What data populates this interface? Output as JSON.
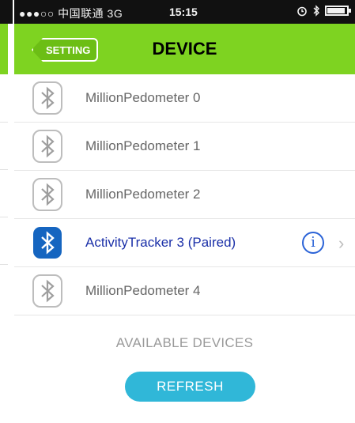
{
  "status_bar": {
    "left": "●●●○○ 中国联通  3G",
    "time": "15:15",
    "alarm_icon": "alarm-icon",
    "bluetooth_icon": "bluetooth-icon",
    "battery_icon": "battery-icon"
  },
  "navbar": {
    "back_label": "SETTING",
    "title": "DEVICE",
    "color": "#7ed321"
  },
  "devices": [
    {
      "name": "MillionPedometer 0",
      "paired": false,
      "icon": "bluetooth-gray-icon"
    },
    {
      "name": "MillionPedometer 1",
      "paired": false,
      "icon": "bluetooth-gray-icon"
    },
    {
      "name": "MillionPedometer 2",
      "paired": false,
      "icon": "bluetooth-gray-icon"
    },
    {
      "name": "ActivityTracker 3 (Paired)",
      "paired": true,
      "icon": "bluetooth-blue-icon",
      "info": "i",
      "chevron": "›"
    },
    {
      "name": "MillionPedometer 4",
      "paired": false,
      "icon": "bluetooth-gray-icon"
    }
  ],
  "section_label": "AVAILABLE DEVICES",
  "refresh_label": "REFRESH",
  "colors": {
    "accent": "#30b7d8",
    "paired_text": "#1a2fa8",
    "info": "#2b63d7"
  }
}
